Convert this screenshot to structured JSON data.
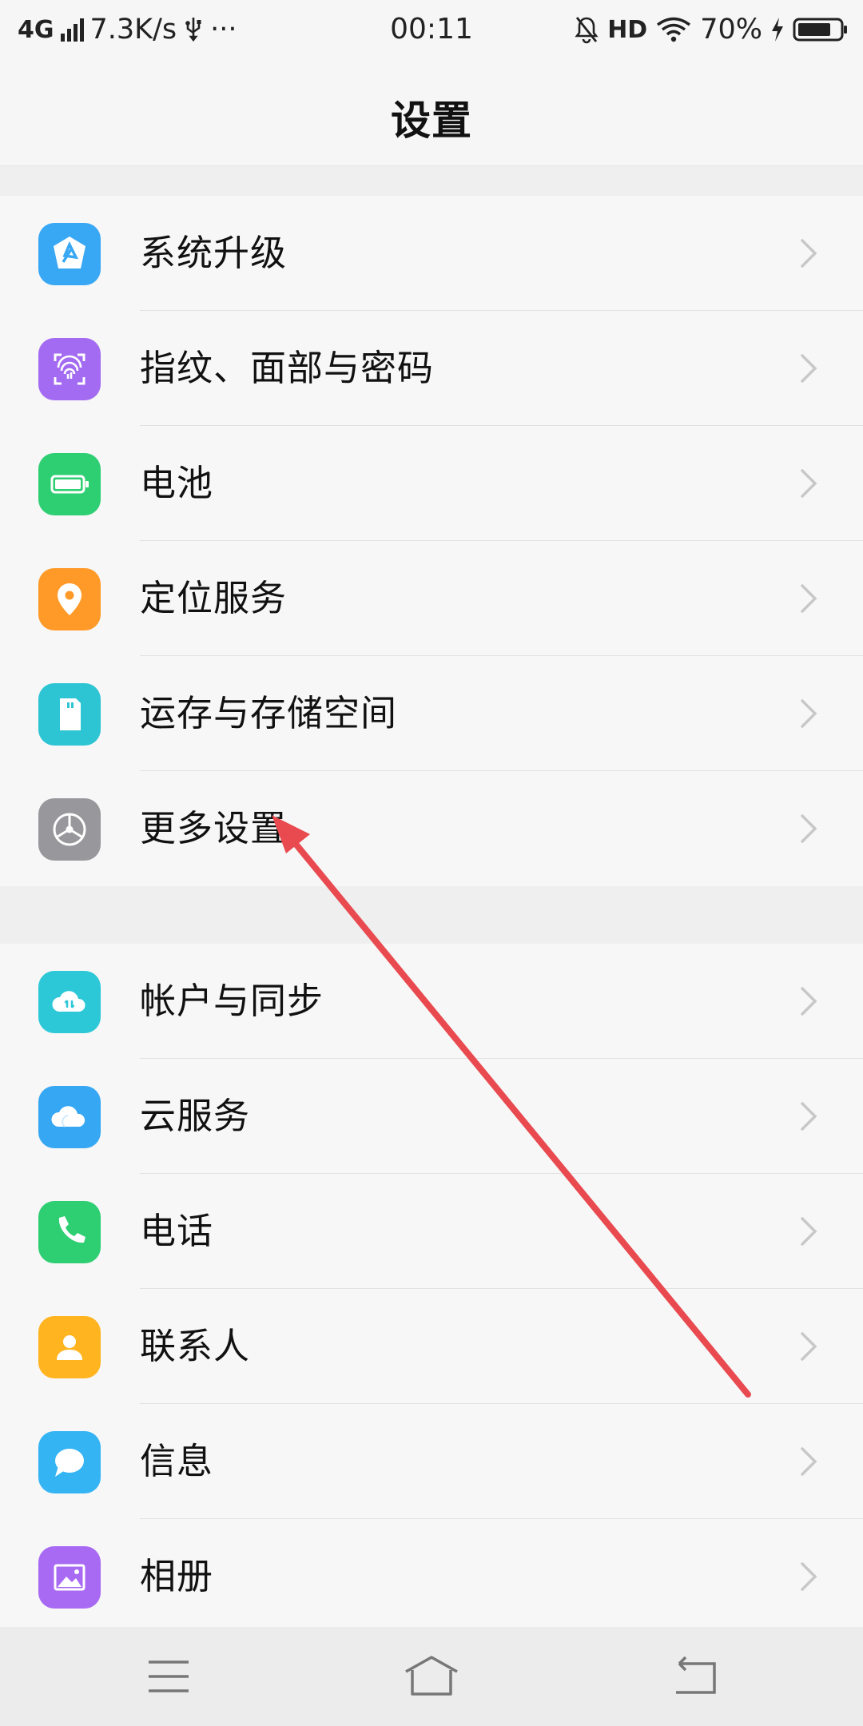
{
  "status_bar": {
    "network": "4G",
    "speed": "7.3K/s",
    "more": "···",
    "time": "00:11",
    "hd": "HD",
    "battery_percent": "70%"
  },
  "header": {
    "title": "设置"
  },
  "group1": [
    {
      "label": "系统升级",
      "icon": "system-update-icon",
      "color": "#3aa8f5"
    },
    {
      "label": "指纹、面部与密码",
      "icon": "fingerprint-icon",
      "color": "#a16af0"
    },
    {
      "label": "电池",
      "icon": "battery-icon",
      "color": "#2ecf73"
    },
    {
      "label": "定位服务",
      "icon": "location-pin-icon",
      "color": "#ff9a2a"
    },
    {
      "label": "运存与存储空间",
      "icon": "sd-card-icon",
      "color": "#2ec5d4"
    },
    {
      "label": "更多设置",
      "icon": "gear-icon",
      "color": "#9a9a9e"
    }
  ],
  "group2": [
    {
      "label": "帐户与同步",
      "icon": "cloud-sync-icon",
      "color": "#2ec9d8"
    },
    {
      "label": "云服务",
      "icon": "cloud-icon",
      "color": "#35a8f4"
    },
    {
      "label": "电话",
      "icon": "phone-icon",
      "color": "#2ecf73"
    },
    {
      "label": "联系人",
      "icon": "contact-icon",
      "color": "#ffb522"
    },
    {
      "label": "信息",
      "icon": "message-icon",
      "color": "#36b5f5"
    },
    {
      "label": "相册",
      "icon": "photo-album-icon",
      "color": "#a86af2"
    }
  ],
  "navbar": [
    "menu-icon",
    "home-icon",
    "back-icon"
  ],
  "annotation": {
    "color": "#e84a4f"
  }
}
